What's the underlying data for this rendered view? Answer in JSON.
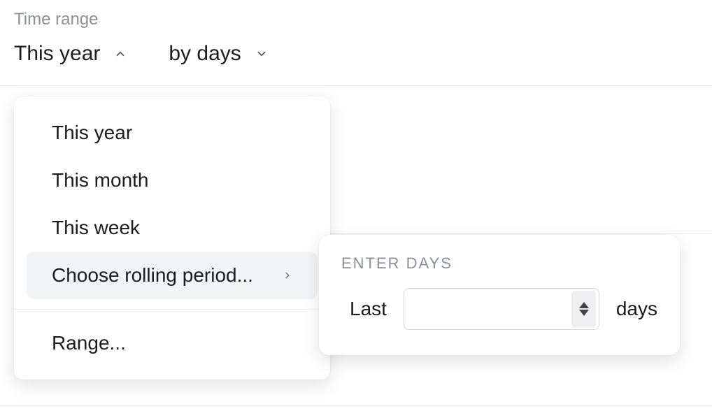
{
  "section_label": "Time range",
  "range_selector": {
    "value": "This year",
    "open": true
  },
  "granularity_selector": {
    "value": "by days",
    "open": false
  },
  "range_menu": {
    "items": [
      {
        "label": "This year"
      },
      {
        "label": "This month"
      },
      {
        "label": "This week"
      },
      {
        "label": "Choose rolling period...",
        "submenu": true,
        "hovered": true
      }
    ],
    "range_item": {
      "label": "Range..."
    }
  },
  "rolling_flyout": {
    "title": "ENTER DAYS",
    "prefix": "Last",
    "value": "",
    "suffix": "days"
  }
}
